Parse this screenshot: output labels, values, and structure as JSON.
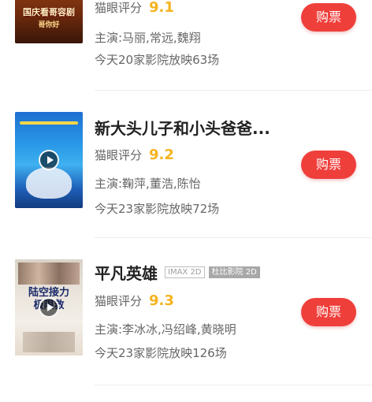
{
  "movies": [
    {
      "title": "",
      "rating_label": "猫眼评分",
      "score": "9.1",
      "cast": "主演:马丽,常远,魏翔",
      "showings": "今天20家影院放映63场",
      "buy_label": "购票",
      "poster": {
        "line1": "",
        "line2": "国庆看哥容剧",
        "line3": "哥你好"
      }
    },
    {
      "title": "新大头儿子和小头爸爸...",
      "rating_label": "猫眼评分",
      "score": "9.2",
      "cast": "主演:鞠萍,董浩,陈怡",
      "showings": "今天23家影院放映72场",
      "buy_label": "购票",
      "poster": {
        "line1": "",
        "line2": "",
        "line3": ""
      }
    },
    {
      "title": "平凡英雄",
      "tags": [
        "IMAX 2D",
        "杜比影院 2D"
      ],
      "rating_label": "猫眼评分",
      "score": "9.3",
      "cast": "主演:李冰冰,冯绍峰,黄晓明",
      "showings": "今天23家影院放映126场",
      "buy_label": "购票",
      "poster": {
        "line1": "陆空接力",
        "line2": "极限救",
        "line3": ""
      }
    }
  ],
  "colors": {
    "buy_button": "#ef3f3b",
    "score": "#f4b31f"
  },
  "icons": [
    "play-icon"
  ]
}
